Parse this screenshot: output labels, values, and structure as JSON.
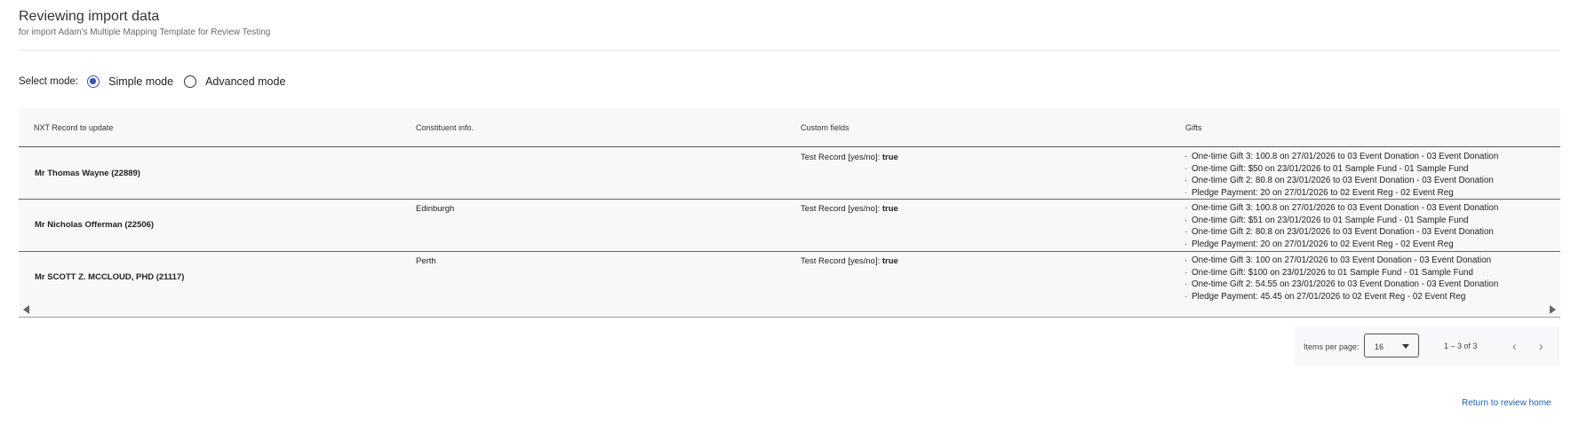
{
  "header": {
    "title": "Reviewing import data",
    "subtitle": "for import Adam's Multiple Mapping Template for Review Testing"
  },
  "mode": {
    "label": "Select mode:",
    "options": [
      {
        "label": "Simple mode",
        "selected": true
      },
      {
        "label": "Advanced mode",
        "selected": false
      }
    ]
  },
  "table": {
    "columns": [
      "NXT Record to update",
      "Constituent info.",
      "Custom fields",
      "Gifts"
    ],
    "rows": [
      {
        "record": "Mr Thomas Wayne (22889)",
        "constituent": "",
        "custom_label": "Test Record [yes/no]:",
        "custom_value": "true",
        "gifts": [
          "One-time Gift 3: 100.8 on 27/01/2026 to 03 Event Donation - 03 Event Donation",
          "One-time Gift: $50 on 23/01/2026 to 01 Sample Fund - 01 Sample Fund",
          "One-time Gift 2: 80.8 on 23/01/2026 to 03 Event Donation - 03 Event Donation",
          "Pledge Payment: 20 on 27/01/2026 to 02 Event Reg - 02 Event Reg"
        ]
      },
      {
        "record": "Mr Nicholas Offerman (22506)",
        "constituent": "Edinburgh",
        "custom_label": "Test Record [yes/no]:",
        "custom_value": "true",
        "gifts": [
          "One-time Gift 3: 100.8 on 27/01/2026 to 03 Event Donation - 03 Event Donation",
          "One-time Gift: $51 on 23/01/2026 to 01 Sample Fund - 01 Sample Fund",
          "One-time Gift 2: 80.8 on 23/01/2026 to 03 Event Donation - 03 Event Donation",
          "Pledge Payment: 20 on 27/01/2026 to 02 Event Reg - 02 Event Reg"
        ]
      },
      {
        "record": "Mr SCOTT Z. MCCLOUD, PHD (21117)",
        "constituent": "Perth",
        "custom_label": "Test Record [yes/no]:",
        "custom_value": "true",
        "gifts": [
          "One-time Gift 3: 100 on 27/01/2026 to 03 Event Donation - 03 Event Donation",
          "One-time Gift: $100 on 23/01/2026 to 01 Sample Fund - 01 Sample Fund",
          "One-time Gift 2: 54.55 on 23/01/2026 to 03 Event Donation - 03 Event Donation",
          "Pledge Payment: 45.45 on 27/01/2026 to 02 Event Reg - 02 Event Reg"
        ]
      }
    ]
  },
  "paginator": {
    "items_label": "Items per page:",
    "items_value": "16",
    "range": "1 – 3 of 3"
  },
  "footer": {
    "return_link": "Return to review home"
  },
  "colors": {
    "accent": "#3f51b5",
    "link": "#1f5fa8"
  }
}
